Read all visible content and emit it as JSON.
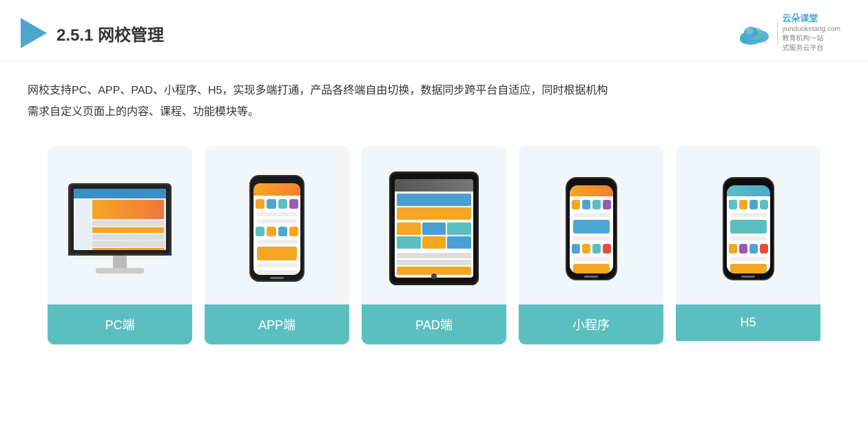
{
  "header": {
    "section_number": "2.5.1",
    "title_plain": "网校管理",
    "logo_domain": "yunduoketang.com",
    "logo_name": "云朵课堂",
    "logo_tagline1": "教育机构一站",
    "logo_tagline2": "式服务云平台"
  },
  "description": {
    "line1": "网校支持PC、APP、PAD、小程序、H5，实现多端打通，产品各终端自由切换，数据同步跨平台自适应，同时根据机构",
    "line2": "需求自定义页面上的内容、课程、功能模块等。"
  },
  "cards": [
    {
      "id": "pc",
      "label": "PC端"
    },
    {
      "id": "app",
      "label": "APP端"
    },
    {
      "id": "pad",
      "label": "PAD端"
    },
    {
      "id": "miniapp",
      "label": "小程序"
    },
    {
      "id": "h5",
      "label": "H5"
    }
  ],
  "colors": {
    "card_label_bg": "#5bbfbf",
    "card_bg": "#f0f6fa",
    "accent_orange": "#f5a623",
    "accent_blue": "#4a9fd5",
    "accent_teal": "#5bbfbf"
  }
}
